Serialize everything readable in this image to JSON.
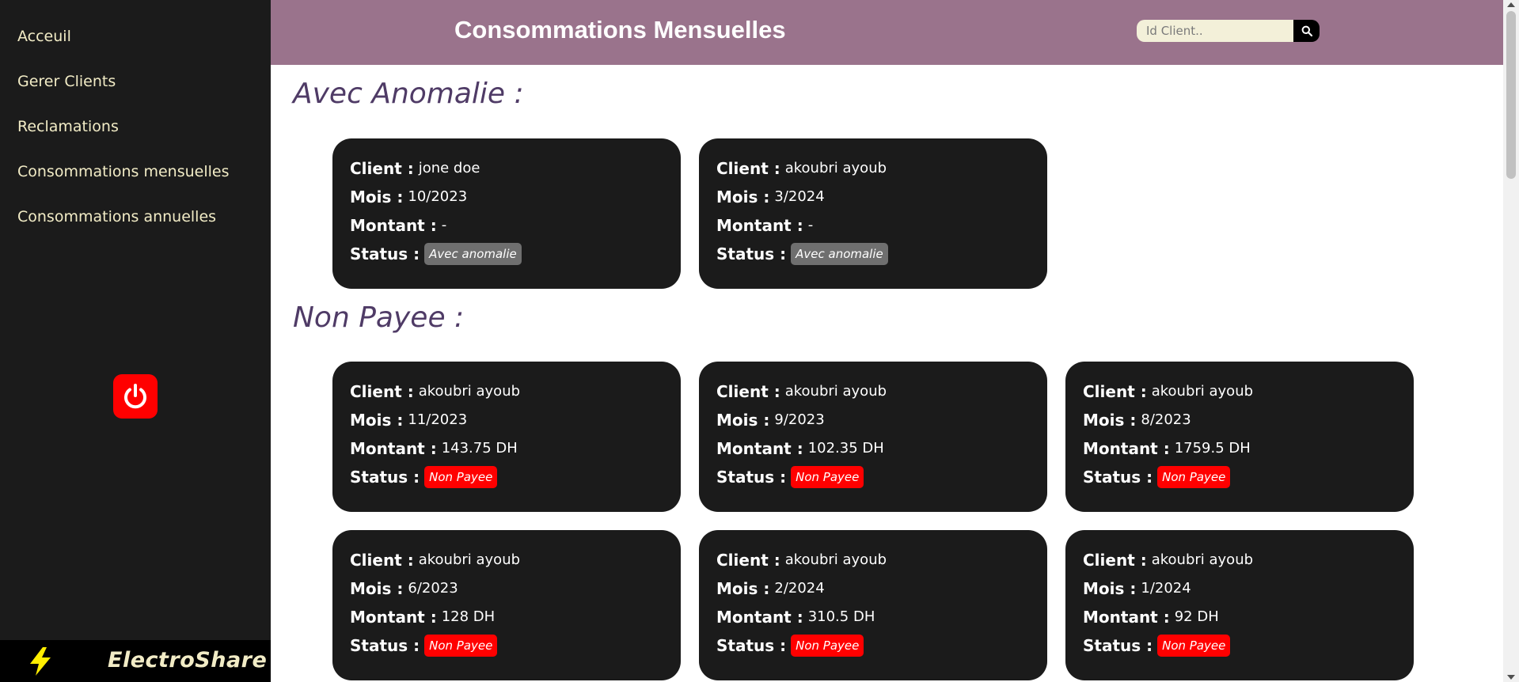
{
  "sidebar": {
    "items": [
      {
        "label": "Acceuil"
      },
      {
        "label": "Gerer Clients"
      },
      {
        "label": "Reclamations"
      },
      {
        "label": "Consommations mensuelles"
      },
      {
        "label": "Consommations annuelles"
      }
    ],
    "logout_icon": "power-icon",
    "brand": {
      "name": "ElectroShare",
      "icon": "lightning-bolt-icon"
    }
  },
  "header": {
    "title": "Consommations Mensuelles",
    "search": {
      "placeholder": "Id Client..",
      "icon": "search-icon"
    }
  },
  "labels": {
    "client": "Client :",
    "mois": "Mois :",
    "montant": "Montant :",
    "status": "Status :"
  },
  "sections": {
    "anomalie": {
      "title": "Avec Anomalie :",
      "cards": [
        {
          "client": "jone doe",
          "mois": "10/2023",
          "montant": "-",
          "status": "Avec anomalie"
        },
        {
          "client": "akoubri ayoub",
          "mois": "3/2024",
          "montant": "-",
          "status": "Avec anomalie"
        }
      ]
    },
    "non_payee": {
      "title": "Non Payee :",
      "cards": [
        {
          "client": "akoubri ayoub",
          "mois": "11/2023",
          "montant": "143.75 DH",
          "status": "Non Payee"
        },
        {
          "client": "akoubri ayoub",
          "mois": "9/2023",
          "montant": "102.35 DH",
          "status": "Non Payee"
        },
        {
          "client": "akoubri ayoub",
          "mois": "8/2023",
          "montant": "1759.5 DH",
          "status": "Non Payee"
        },
        {
          "client": "akoubri ayoub",
          "mois": "6/2023",
          "montant": "128 DH",
          "status": "Non Payee"
        },
        {
          "client": "akoubri ayoub",
          "mois": "2/2024",
          "montant": "310.5 DH",
          "status": "Non Payee"
        },
        {
          "client": "akoubri ayoub",
          "mois": "1/2024",
          "montant": "92 DH",
          "status": "Non Payee"
        }
      ]
    }
  },
  "colors": {
    "header_bg": "#9a738c",
    "sidebar_bg": "#1b1b1b",
    "card_bg": "#1b1b1b",
    "section_title": "#4f3b66",
    "non_payee_badge": "#ff0000",
    "anomalie_badge": "#6f6f6f",
    "nav_text": "#f2ecc6"
  }
}
